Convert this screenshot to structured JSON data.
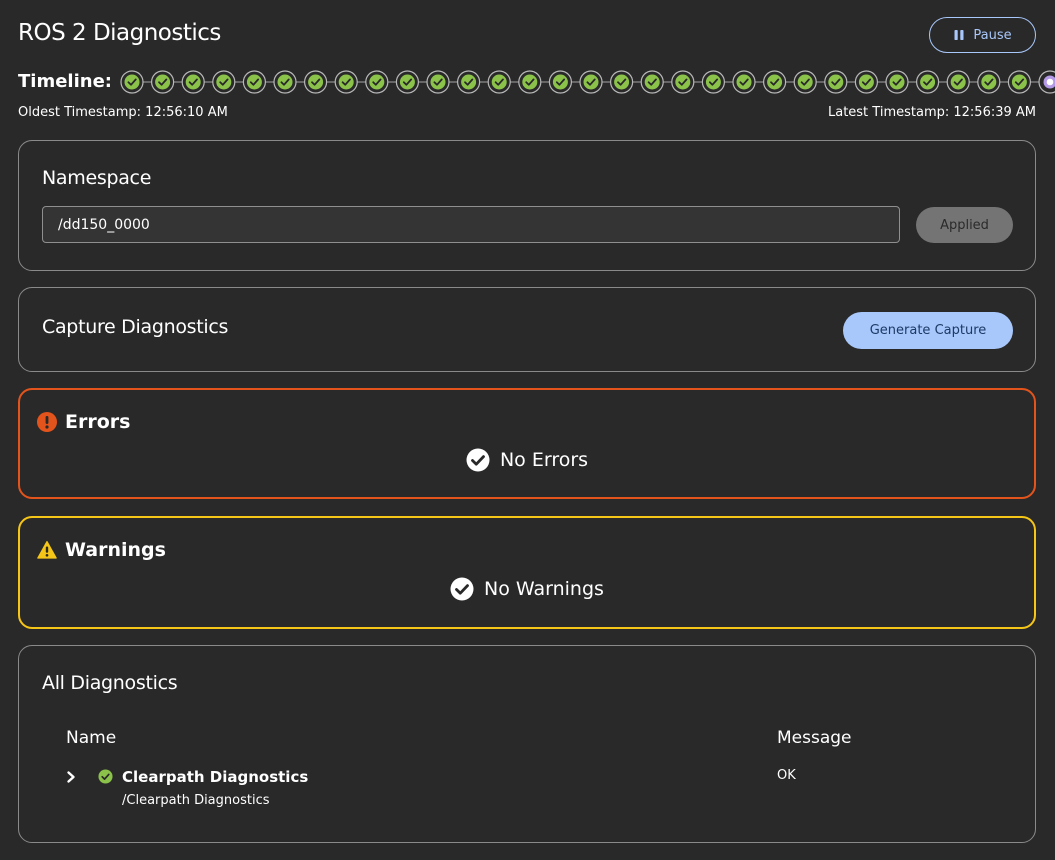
{
  "header": {
    "title": "ROS 2 Diagnostics",
    "pause_label": "Pause"
  },
  "timeline": {
    "label": "Timeline:",
    "oldest": "Oldest Timestamp: 12:56:10 AM",
    "latest": "Latest Timestamp: 12:56:39 AM",
    "ok_count": 30,
    "selected_index": 30
  },
  "namespace": {
    "title": "Namespace",
    "value": "/dd150_0000",
    "applied_label": "Applied"
  },
  "capture": {
    "title": "Capture Diagnostics",
    "button_label": "Generate Capture"
  },
  "errors": {
    "title": "Errors",
    "empty_label": "No Errors"
  },
  "warnings": {
    "title": "Warnings",
    "empty_label": "No Warnings"
  },
  "all_diagnostics": {
    "title": "All Diagnostics",
    "columns": {
      "name": "Name",
      "message": "Message"
    },
    "rows": [
      {
        "name": "Clearpath Diagnostics",
        "path": "/Clearpath Diagnostics",
        "message": "OK",
        "status": "ok"
      }
    ]
  },
  "colors": {
    "ok_green": "#8bc34a",
    "error_orange": "#e2541c",
    "warning_yellow": "#f5c518",
    "accent_blue": "#a8c7fa",
    "selected_purple": "#b49ae6"
  }
}
